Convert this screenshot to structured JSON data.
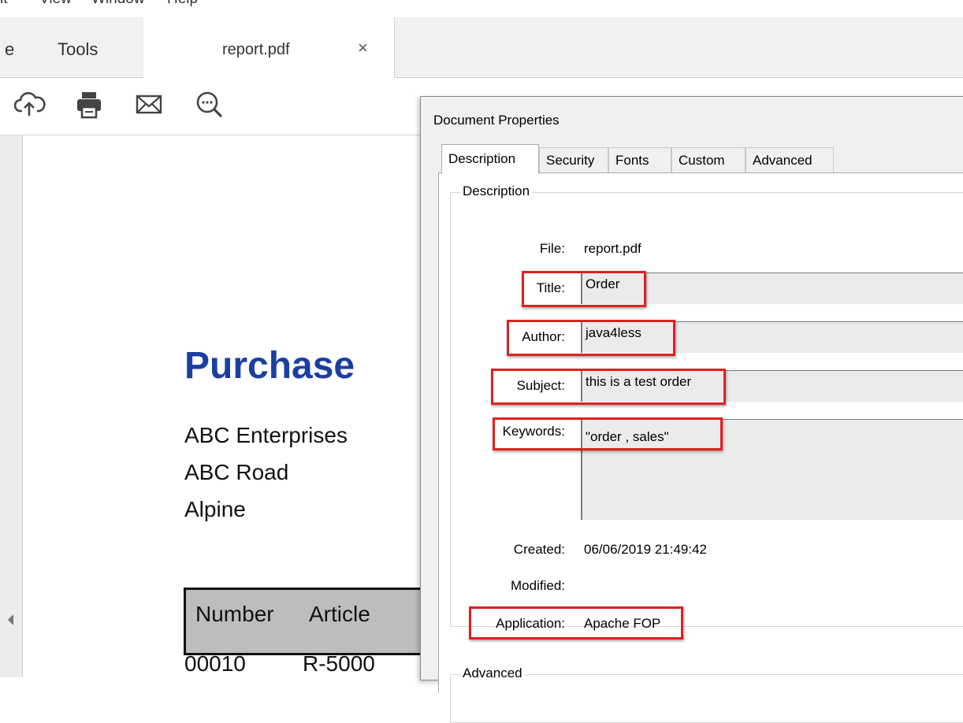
{
  "menu": [
    "it",
    "View",
    "Window",
    "Help"
  ],
  "tabs": {
    "home_label": "e",
    "tools_label": "Tools",
    "doc_label": "report.pdf",
    "close_glyph": "×"
  },
  "toolbar_icons": [
    "cloud-upload-icon",
    "print-icon",
    "email-icon",
    "zoom-icon"
  ],
  "document": {
    "title": "Purchase",
    "address": [
      "ABC Enterprises",
      "ABC Road",
      "Alpine"
    ],
    "table_headers": [
      "Number",
      "Article"
    ],
    "first_row": [
      "00010",
      "R-5000"
    ]
  },
  "dialog": {
    "title": "Document Properties",
    "tabs": [
      "Description",
      "Security",
      "Fonts",
      "Custom",
      "Advanced"
    ],
    "active_tab": "Description",
    "description_group": "Description",
    "advanced_group": "Advanced",
    "fields": {
      "file_label": "File:",
      "file_value": "report.pdf",
      "title_label": "Title:",
      "title_value": "Order",
      "author_label": "Author:",
      "author_value": "java4less",
      "subject_label": "Subject:",
      "subject_value": "this is a test order",
      "keywords_label": "Keywords:",
      "keywords_value": "\"order , sales\"",
      "created_label": "Created:",
      "created_value": "06/06/2019 21:49:42",
      "modified_label": "Modified:",
      "modified_value": "",
      "application_label": "Application:",
      "application_value": "Apache FOP"
    }
  },
  "colors": {
    "doc_title": "#1a3fa0",
    "highlight": "#e02020"
  }
}
